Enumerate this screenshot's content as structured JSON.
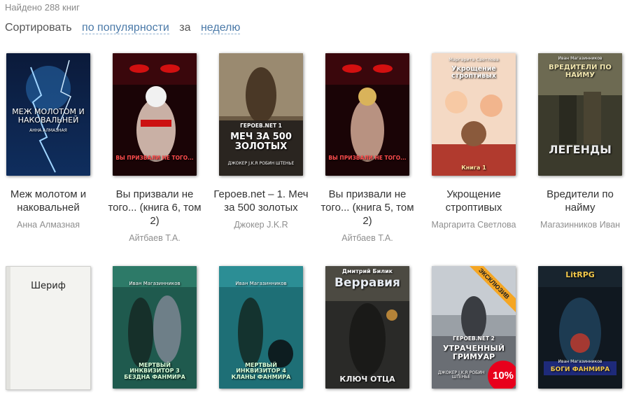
{
  "results": {
    "found_text": "Найдено 288 книг"
  },
  "sort": {
    "label": "Сортировать",
    "by": "по популярности",
    "for_label": "за",
    "period": "неделю"
  },
  "books": [
    {
      "title": "Меж молотом и наковальней",
      "author": "Анна Алмазная",
      "cover_text": "МЕЖ МОЛОТОМ И НАКОВАЛЬНЕЙ",
      "cover_sub": "АННА АЛМАЗНАЯ"
    },
    {
      "title": "Вы призвали не того... (книга 6, том 2)",
      "author": "Айтбаев Т.А.",
      "cover_text": "ВЫ ПРИЗВАЛИ НЕ ТОГО..."
    },
    {
      "title": "Героев.net – 1. Меч за 500 золотых",
      "author": "Джокер J.K.R",
      "cover_text": "МЕЧ ЗА 500 ЗОЛОТЫХ",
      "cover_series": "ГЕРОЕВ.NET 1",
      "cover_sub": "ДЖОКЕР J.K.R РОБИН ШТЕНЬЕ"
    },
    {
      "title": "Вы призвали не того... (книга 5, том 2)",
      "author": "Айтбаев Т.А.",
      "cover_text": "ВЫ ПРИЗВАЛИ НЕ ТОГО..."
    },
    {
      "title": "Укрощение строптивых",
      "author": "Маргарита Светлова",
      "cover_text": "Укрощение строптивых",
      "cover_series": "Маргарита Светлова",
      "cover_sub": "Книга 1"
    },
    {
      "title": "Вредители по найму",
      "author": "Магазинников Иван",
      "cover_text": "ВРЕДИТЕЛИ ПО НАЙМУ",
      "cover_series": "Иван Магазинников",
      "cover_sub": "ЛЕГЕНДЫ"
    },
    {
      "cover_text": "Шериф"
    },
    {
      "cover_text": "МЕРТВЫЙ ИНКВИЗИТОР 3 БЕЗДНА ФАНМИРА",
      "cover_series": "Иван Магазинников"
    },
    {
      "cover_text": "МЕРТВЫЙ ИНКВИЗИТОР 4 КЛАНЫ ФАНМИРА",
      "cover_series": "Иван Магазинников"
    },
    {
      "cover_text": "Верравия",
      "cover_series": "Дмитрий Билик",
      "cover_sub": "КЛЮЧ ОТЦА"
    },
    {
      "cover_text": "УТРАЧЕННЫЙ ГРИМУАР",
      "cover_series": "ГЕРОЕВ.NET 2",
      "cover_sub": "ДЖОКЕР J.K.R РОБИН ШТЕНЬЕ",
      "badge": "ЭКСКЛЮЗИВ",
      "discount": "10%"
    },
    {
      "cover_text": "БОГИ ФАНМИРА",
      "cover_series": "LitRPG",
      "cover_sub": "Иван Магазинников"
    }
  ],
  "colors": {
    "link": "#4a79a8",
    "muted": "#8f8f8f",
    "discount": "#e8001c",
    "ribbon": "#f5a623"
  }
}
